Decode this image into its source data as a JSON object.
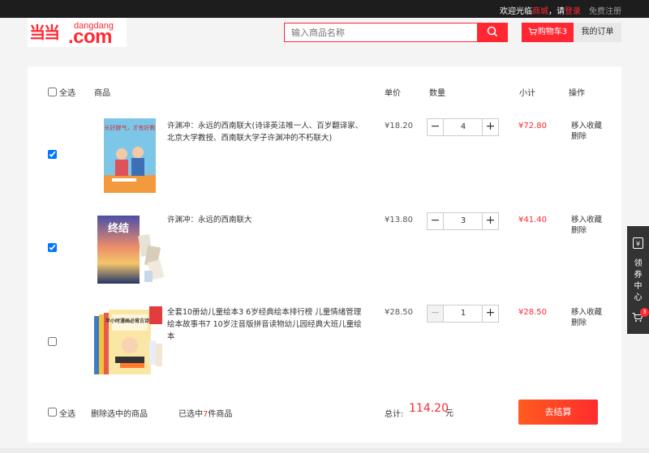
{
  "topbar": {
    "welcome": "欢迎光临",
    "mall": "商城",
    "please": "，请",
    "login": "登录",
    "register": "免费注册"
  },
  "logo": {
    "mark": "当当",
    "small": "dangdang",
    "big": ".com"
  },
  "search": {
    "placeholder": "输入商品名称",
    "icon": "search-icon"
  },
  "header": {
    "cart": "购物车3",
    "orders": "我的订单"
  },
  "table": {
    "select_all": "全选",
    "col_product": "商品",
    "col_price": "单价",
    "col_qty": "数量",
    "col_subtotal": "小计",
    "col_ops": "操作"
  },
  "items": [
    {
      "checked": true,
      "title": "许渊冲：永远的西南联大(诗译英法唯一人、百岁翻译家、北京大学教授、西南联大学子许渊冲的不朽联大)",
      "price": "¥18.20",
      "qty": "4",
      "subtotal": "¥72.80",
      "favorite": "移入收藏",
      "delete": "删除",
      "cover_text": "家长好脾气，才有好教育"
    },
    {
      "checked": true,
      "title": "许渊冲：永远的西南联大",
      "price": "¥13.80",
      "qty": "3",
      "subtotal": "¥41.40",
      "favorite": "移入收藏",
      "delete": "删除",
      "cover_text": "终结"
    },
    {
      "checked": false,
      "title": "全套10册幼儿童绘本3 6岁经典绘本排行榜 儿童情绪管理绘本故事书7 10岁注音版拼音读物幼儿园经典大班儿童绘本",
      "price": "¥28.50",
      "qty": "1",
      "subtotal": "¥28.50",
      "favorite": "移入收藏",
      "delete": "删除",
      "cover_text": "半小时漫画必背古诗词"
    }
  ],
  "footer": {
    "select_all": "全选",
    "delete_selected": "删除选中的商品",
    "selected_prefix": "已选中",
    "selected_count": "7",
    "selected_suffix": "件商品",
    "total_label": "总计:",
    "total_amount": "114.20",
    "yuan": "元",
    "checkout": "去结算"
  },
  "sidebar": {
    "coupon": "领券中心",
    "cart_badge": "3"
  },
  "colors": {
    "accent": "#ff2832",
    "dark": "#1d1d1d"
  }
}
